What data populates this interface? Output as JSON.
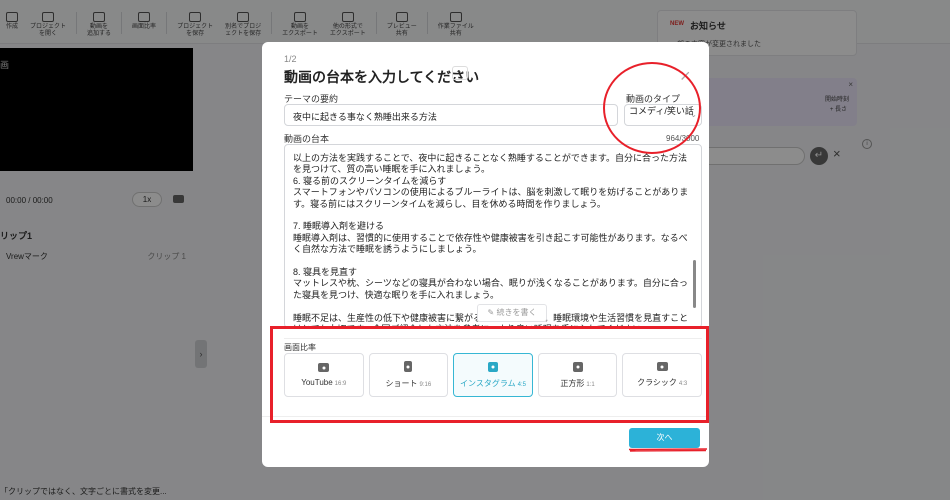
{
  "toolbar": {
    "items": [
      {
        "label": "作成",
        "sub": ""
      },
      {
        "label": "プロジェクト",
        "sub": "を開く"
      },
      {
        "label": "動画を",
        "sub": "追加する"
      },
      {
        "label": "画面比率",
        "sub": ""
      },
      {
        "label": "プロジェクト",
        "sub": "を保存"
      },
      {
        "label": "別名でプロジ",
        "sub": "ェクトを保存"
      },
      {
        "label": "動画を",
        "sub": "エクスポート"
      },
      {
        "label": "他の形式で",
        "sub": "エクスポート"
      },
      {
        "label": "プレビュー",
        "sub": "共有"
      },
      {
        "label": "作業ファイル",
        "sub": "共有"
      }
    ]
  },
  "player": {
    "preview_mark": "画",
    "time": "00:00 / 00:00",
    "speed": "1x"
  },
  "clips": {
    "title": "リップ1",
    "row_left": "Vrewマーク",
    "row_right": "クリップ 1"
  },
  "bottom_note": "「クリップではなく、文字ごとに書式を変更...",
  "notice": {
    "badge": "NEW",
    "title": "お知らせ",
    "subtitle": "一部の内容が変更されました"
  },
  "purple_box": {
    "close": "×",
    "line1": "開始時刻",
    "line2": "+ 長さ"
  },
  "modal": {
    "step": "1/2",
    "title": "動画の台本を入力してください",
    "more": "···",
    "close": "×",
    "theme_label": "テーマの要約",
    "theme_value": "夜中に起きる事なく熟睡出来る方法",
    "type_label": "動画のタイプ",
    "type_value": "コメディ/笑い話",
    "script_label": "動画の台本",
    "counter": "964/3000",
    "script_text": "以上の方法を実践することで、夜中に起きることなく熟睡することができます。自分に合った方法を見つけて、質の高い睡眠を手に入れましょう。\n6. 寝る前のスクリーンタイムを減らす\nスマートフォンやパソコンの使用によるブルーライトは、脳を刺激して眠りを妨げることがあります。寝る前にはスクリーンタイムを減らし、目を休める時間を作りましょう。\n\n7. 睡眠導入剤を避ける\n睡眠導入剤は、習慣的に使用することで依存性や健康被害を引き起こす可能性があります。なるべく自然な方法で睡眠を誘うようにしましょう。\n\n8. 寝具を見直す\nマットレスや枕、シーツなどの寝具が合わない場合、眠りが浅くなることがあります。自分に合った寝具を見つけ、快適な眠りを手に入れましょう。\n\n睡眠不足は、生産性の低下や健康被害に繋がる恐れがあります。睡眠環境や生活習慣を見直すことはとても大切です。今回ご紹介した方法を参考に、より良い睡眠を手に入れてください。",
    "continue_label": "続きを書く",
    "ratio_label": "画面比率",
    "ratios": [
      {
        "name": "YouTube",
        "ratio": "16:9",
        "selected": false
      },
      {
        "name": "ショート",
        "ratio": "9:16",
        "selected": false
      },
      {
        "name": "インスタグラム",
        "ratio": "4:5",
        "selected": true
      },
      {
        "name": "正方形",
        "ratio": "1:1",
        "selected": false
      },
      {
        "name": "クラシック",
        "ratio": "4:3",
        "selected": false
      }
    ],
    "next_label": "次へ"
  },
  "colors": {
    "accent": "#2cb2d8",
    "annotation": "#e8202a"
  }
}
